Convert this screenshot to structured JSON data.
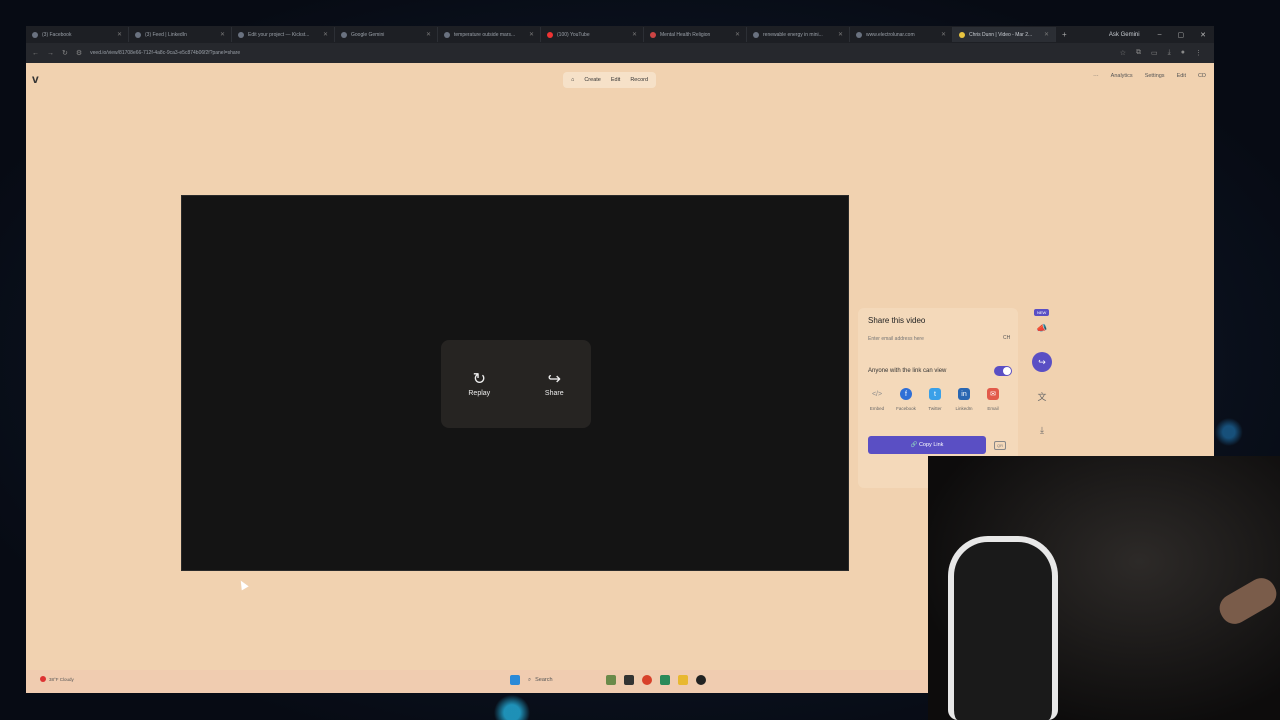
{
  "browser": {
    "tabs": [
      {
        "label": "(3) Facebook"
      },
      {
        "label": "(3) Feed | LinkedIn"
      },
      {
        "label": "Edit your project — Kickst..."
      },
      {
        "label": "Google Gemini"
      },
      {
        "label": "temperature outside mars..."
      },
      {
        "label": "(100) YouTube"
      },
      {
        "label": "Mental Health Religion"
      },
      {
        "label": "renewable energy in mini..."
      },
      {
        "label": "www.electrolunar.com"
      },
      {
        "label": "Chris Dunn | Video - Mar 2..."
      }
    ],
    "ask_gemini": "Ask Gemini",
    "url": "veed.io/view/81708e66-712f-4a8c-9ca3-e5c874b06f2f?panel=share"
  },
  "app": {
    "logo": "v",
    "nav": {
      "home": "⌂",
      "create": "Create",
      "edit": "Edit",
      "record": "Record"
    },
    "topright": {
      "more": "···",
      "analytics": "Analytics",
      "settings": "Settings",
      "edit": "Edit",
      "user": "CD"
    }
  },
  "video": {
    "replay_label": "Replay",
    "share_label": "Share"
  },
  "share_panel": {
    "title": "Share this video",
    "email_placeholder": "Enter email address here",
    "email_tag": "CH",
    "access_label": "Anyone with the link can view",
    "access_enabled": true,
    "socials": [
      {
        "label": "Embed",
        "icon": "</>",
        "color": "#8a8a8a"
      },
      {
        "label": "Facebook",
        "icon": "f",
        "color": "#2f6fd6"
      },
      {
        "label": "Twitter",
        "icon": "t",
        "color": "#3aa0e8"
      },
      {
        "label": "LinkedIn",
        "icon": "in",
        "color": "#2a67b2"
      },
      {
        "label": "Email",
        "icon": "✉",
        "color": "#e25a4a"
      }
    ],
    "copy_link_label": "Copy Link",
    "qr_label": "QR"
  },
  "side_tools": {
    "new_badge": "NEW"
  },
  "taskbar": {
    "weather": "38°F Cloudy",
    "search_label": "Search"
  }
}
